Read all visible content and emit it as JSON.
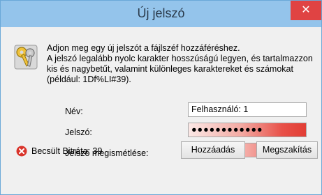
{
  "window": {
    "title": "Új jelszó",
    "close_glyph": "✕"
  },
  "dialog": {
    "description": "Adjon meg egy új jelszót a fájlszéf hozzáféréshez.\nA jelszó legalább nyolc karakter hosszúságú legyen, és tartalmazzon kis és nagybetűt, valamint különleges karaktereket és számokat (például: 1Df%LI#39).",
    "icon": "keys-icon",
    "fields": {
      "name_label": "Név:",
      "name_value": "Felhasználó: 1",
      "password_label": "Jelszó:",
      "password_value": "●●●●●●●●●●●●",
      "confirm_label": "Jelszó megismétlése:",
      "confirm_value": ""
    },
    "status": {
      "icon": "error-icon",
      "text": "Becsült Bitráta: 39",
      "color": "#d9342b"
    },
    "buttons": {
      "add": "Hozzáadás",
      "cancel": "Megszakítás"
    }
  }
}
